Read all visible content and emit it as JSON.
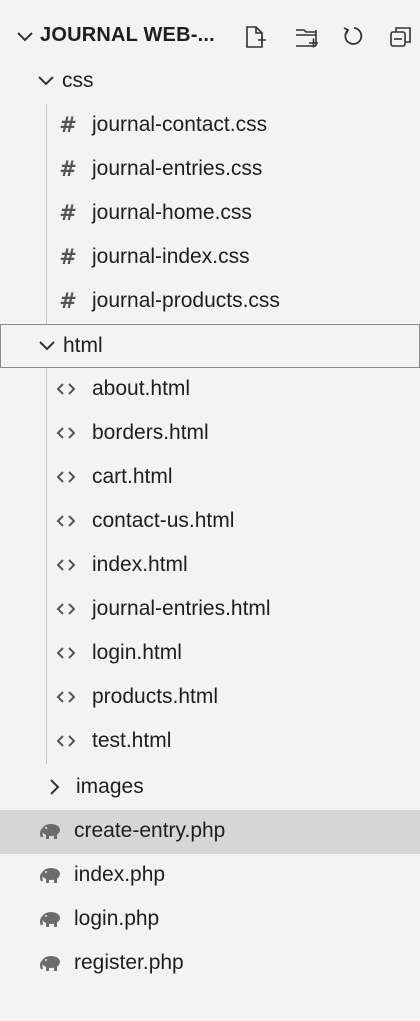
{
  "explorer": {
    "title": "JOURNAL WEB-...",
    "header_icons": [
      "new-file-icon",
      "new-folder-icon",
      "refresh-icon",
      "collapse-all-icon"
    ],
    "css_folder": {
      "label": "css",
      "files": [
        "journal-contact.css",
        "journal-entries.css",
        "journal-home.css",
        "journal-index.css",
        "journal-products.css"
      ]
    },
    "html_folder": {
      "label": "html",
      "files": [
        "about.html",
        "borders.html",
        "cart.html",
        "contact-us.html",
        "index.html",
        "journal-entries.html",
        "login.html",
        "products.html",
        "test.html"
      ]
    },
    "images_folder": {
      "label": "images"
    },
    "php_files": [
      "create-entry.php",
      "index.php",
      "login.php",
      "register.php"
    ],
    "selected_file": "create-entry.php",
    "focused_folder": "html"
  }
}
